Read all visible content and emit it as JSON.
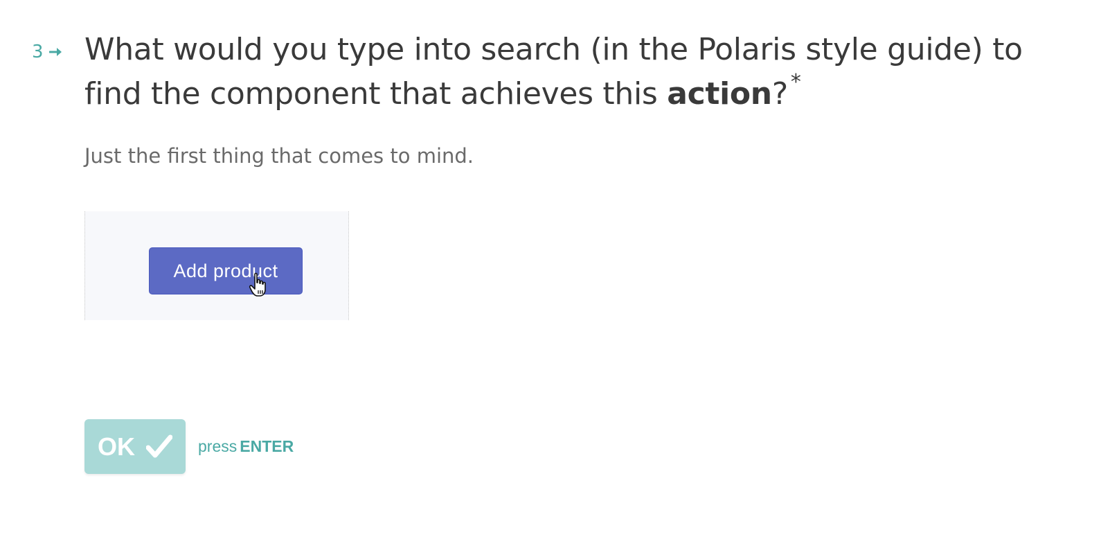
{
  "question": {
    "number": "3",
    "text_before": "What would you type into search (in the Polaris style guide) to find the component that achieves this ",
    "text_bold": "action",
    "text_after": "?",
    "required_marker": "*",
    "description": "Just the first thing that comes to mind."
  },
  "attachment": {
    "button_label": "Add product",
    "button_color": "#5c6ac4",
    "cursor_icon": "hand-pointer-icon"
  },
  "submit": {
    "label": "OK",
    "icon": "check-icon",
    "hint_prefix": "press",
    "hint_key": "ENTER"
  },
  "colors": {
    "accent": "#4aa9a4",
    "ok_background": "#a9d9d7",
    "question_text": "#3a3a3a"
  }
}
